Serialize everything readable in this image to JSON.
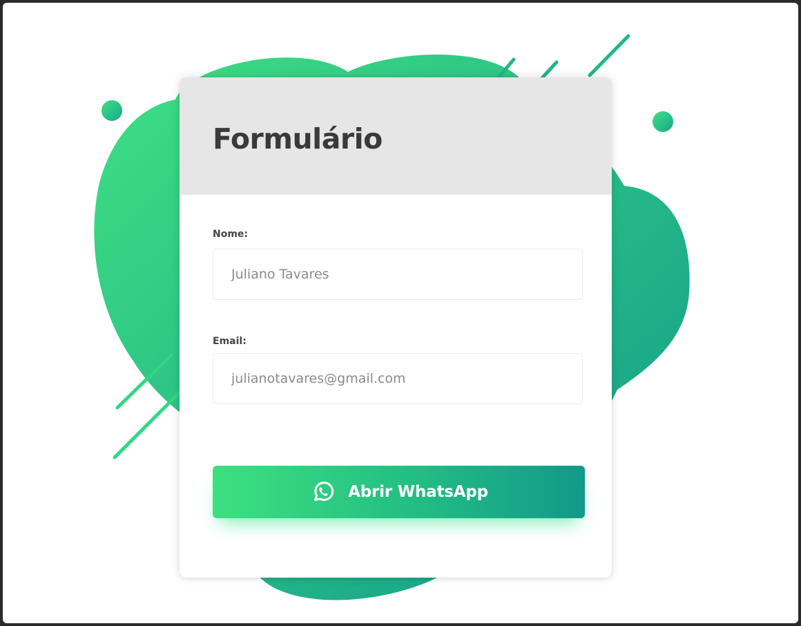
{
  "form": {
    "title": "Formulário",
    "name_label": "Nome:",
    "name_value": "Juliano Tavares",
    "email_label": "Email:",
    "email_value": "julianotavares@gmail.com",
    "submit_label": "Abrir WhatsApp",
    "submit_icon": "whatsapp-icon"
  },
  "colors": {
    "accent_start": "#3de07f",
    "accent_end": "#12998a",
    "header_bg": "#e6e6e6",
    "title_text": "#3a3a3a"
  }
}
